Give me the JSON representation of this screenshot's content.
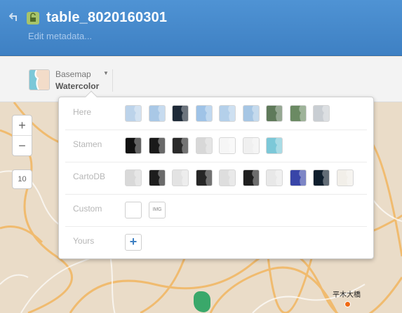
{
  "header": {
    "title": "table_8020160301",
    "subtitle": "Edit metadata...",
    "back_icon": "back-arrow-icon",
    "lock_icon": "unlocked-icon",
    "bg_color": "#3e80c3"
  },
  "toolbar": {
    "basemap_label": "Basemap",
    "basemap_value": "Watercolor"
  },
  "map": {
    "zoom_in": "+",
    "zoom_out": "−",
    "zoom_level": "10",
    "place_label": "平木大橋"
  },
  "basemap_menu": {
    "rows": [
      {
        "label": "Here",
        "tiles": [
          "#bcd3ea",
          "#a9c8e6",
          "#1e2a38",
          "#9fc3e7",
          "#b4d0ea",
          "#a6c6e4",
          "#5f7a5a",
          "#6b8a63",
          "#c9ced3"
        ]
      },
      {
        "label": "Stamen",
        "tiles": [
          "#111111",
          "#1a1a1a",
          "#2a2a2a",
          "#d8d8d8",
          "#f6f6f6",
          "#f0f0f0",
          "#7cc8d8"
        ]
      },
      {
        "label": "CartoDB",
        "tiles": [
          "#d9d9d9",
          "#1d1d1d",
          "#e3e3e3",
          "#262626",
          "#dedede",
          "#1f1f1f",
          "#e8e8e8",
          "#3845a8",
          "#0f1e2d",
          "#f2efe9"
        ]
      },
      {
        "label": "Custom",
        "img_label": "IMG"
      },
      {
        "label": "Yours",
        "add_label": "+"
      }
    ]
  }
}
